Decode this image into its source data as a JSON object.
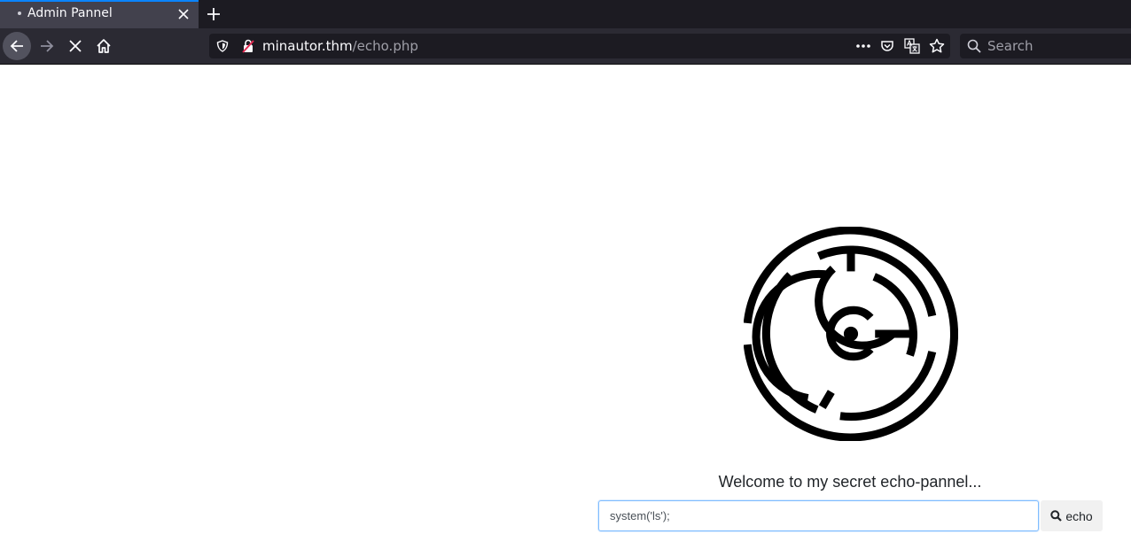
{
  "browser": {
    "tab": {
      "title": "Admin Pannel"
    },
    "url": {
      "host": "minautor.thm",
      "path": "/echo.php"
    },
    "search": {
      "placeholder": "Search"
    }
  },
  "page": {
    "welcome_text": "Welcome to my secret echo-pannel...",
    "input": {
      "value": "system('ls');"
    },
    "echo_button_label": "echo"
  },
  "colors": {
    "accent": "#0a84ff",
    "tabstrip": "#1c1b22",
    "toolbar": "#2b2a33"
  },
  "icons": [
    "close-icon",
    "plus-icon",
    "back-arrow-icon",
    "forward-arrow-icon",
    "stop-icon",
    "home-icon",
    "shield-icon",
    "insecure-lock-icon",
    "more-icon",
    "pocket-icon",
    "translate-icon",
    "star-icon",
    "search-icon",
    "maze-logo-icon"
  ]
}
